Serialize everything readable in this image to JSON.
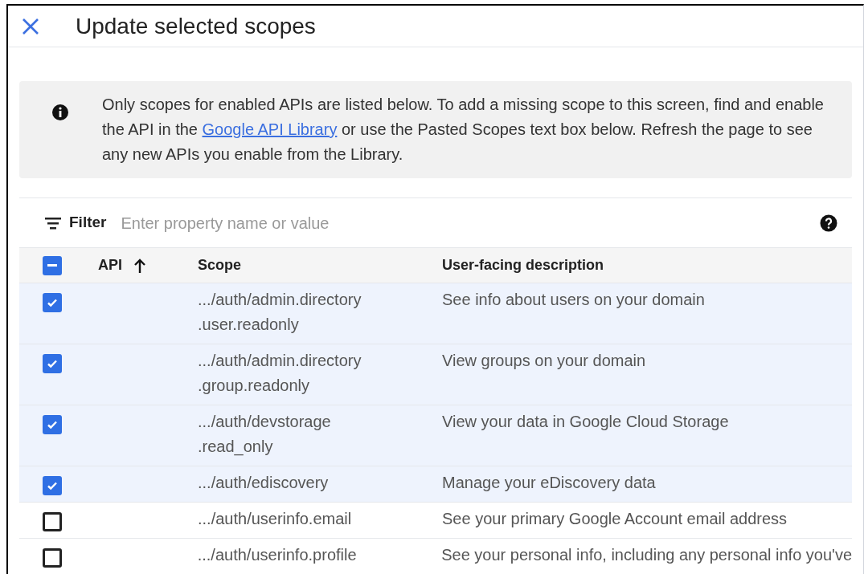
{
  "dialog": {
    "title": "Update selected scopes"
  },
  "notice": {
    "text_before": "Only scopes for enabled APIs are listed below. To add a missing scope to this screen, find and enable the API in the ",
    "link": "Google API Library",
    "text_after": " or use the Pasted Scopes text box below. Refresh the page to see any new APIs you enable from the Library."
  },
  "filter": {
    "label": "Filter",
    "placeholder": "Enter property name or value"
  },
  "table": {
    "select_all": {
      "indeterminate": true
    },
    "columns": [
      {
        "label": "API",
        "sorted": true
      },
      {
        "label": "Scope",
        "sorted": false
      },
      {
        "label": "User-facing description",
        "sorted": false
      }
    ],
    "rows": [
      {
        "selected": true,
        "scope_lines": [
          ".../auth/admin.directory",
          ".user.readonly"
        ],
        "description": "See info about users on your domain"
      },
      {
        "selected": true,
        "scope_lines": [
          ".../auth/admin.directory",
          ".group.readonly"
        ],
        "description": "View groups on your domain"
      },
      {
        "selected": true,
        "scope_lines": [
          ".../auth/devstorage",
          ".read_only"
        ],
        "description": "View your data in Google Cloud Storage"
      },
      {
        "selected": true,
        "scope_lines": [
          ".../auth/ediscovery"
        ],
        "description": "Manage your eDiscovery data"
      },
      {
        "selected": false,
        "scope_lines": [
          ".../auth/userinfo.email"
        ],
        "description": "See your primary Google Account email address"
      },
      {
        "selected": false,
        "scope_lines": [
          ".../auth/userinfo.profile"
        ],
        "description": "See your personal info, including any personal info you've"
      }
    ]
  }
}
